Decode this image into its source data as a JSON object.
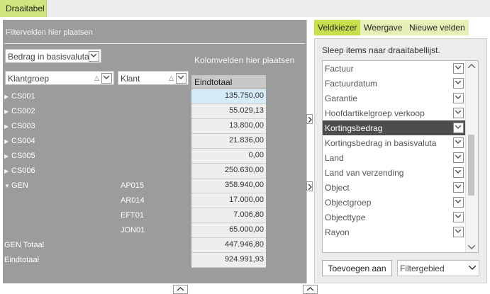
{
  "tab_main": "Draaitabel",
  "filter_area_label": "Filtervelden hier plaatsen",
  "column_area_label": "Kolomvelden hier plaatsen",
  "data_field": "Bedrag in basisvaluta",
  "row_fields": [
    "Klantgroep",
    "Klant"
  ],
  "grand_total_header": "Eindtotaal",
  "rows": [
    {
      "label": "CS001",
      "value": "135.750,00"
    },
    {
      "label": "CS002",
      "value": "55.029,13"
    },
    {
      "label": "CS003",
      "value": "13.800,00"
    },
    {
      "label": "CS004",
      "value": "21.836,00"
    },
    {
      "label": "CS005",
      "value": "0,00"
    },
    {
      "label": "CS006",
      "value": "250.630,00"
    },
    {
      "label": "GEN",
      "sub": "AP015",
      "value": "358.940,00"
    },
    {
      "sub": "AR014",
      "value": "17.000,00"
    },
    {
      "sub": "EFT01",
      "value": "7.006,80"
    },
    {
      "sub": "JON01",
      "value": "65.000,00"
    },
    {
      "label": "GEN Totaal",
      "value": "447.946,80"
    },
    {
      "label": "Eindtotaal",
      "value": "924.991,93"
    }
  ],
  "chooser": {
    "tabs": [
      "Veldkiezer",
      "Weergave",
      "Nieuwe velden"
    ],
    "hint": "Sleep items naar draaitabellijst.",
    "fields": [
      "Factuur",
      "Factuurdatum",
      "Garantie",
      "Hoofdartikelgroep verkoop",
      "Kortingsbedrag",
      "Kortingsbedrag in basisvaluta",
      "Land",
      "Land van verzending",
      "Object",
      "Objectgroep",
      "Objecttype",
      "Rayon"
    ],
    "selected_field": "Kortingsbedrag",
    "add_button": "Toevoegen aan",
    "target_area": "Filtergebied"
  },
  "colors": {
    "accent_tab": "#cfe67e",
    "active_tab": "#c6e04e",
    "pivot_bg": "#9c9c9c",
    "selected_cell": "#d5ebf8"
  }
}
